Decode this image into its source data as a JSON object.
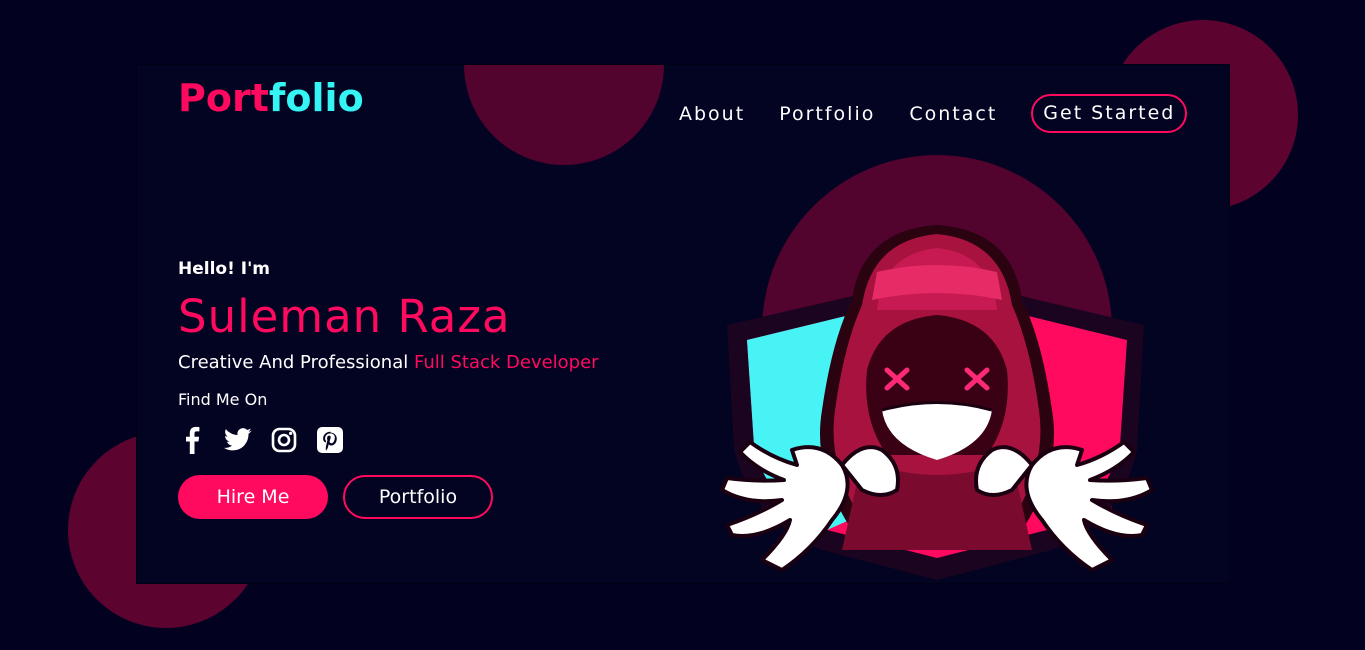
{
  "brand": {
    "logo_part1": "Port",
    "logo_part2": "folio",
    "accent_color": "#ff0a5e",
    "secondary_color": "#35f4f4"
  },
  "nav": {
    "links": [
      "About",
      "Portfolio",
      "Contact"
    ],
    "cta_label": "Get Started"
  },
  "hero": {
    "greeting": "Hello! I'm",
    "name": "Suleman Raza",
    "tagline_prefix": "Creative And Professional ",
    "tagline_highlight": "Full Stack Developer",
    "find_me": "Find Me On",
    "socials": [
      "facebook-icon",
      "twitter-icon",
      "instagram-icon",
      "pinterest-icon"
    ],
    "primary_button": "Hire Me",
    "secondary_button": "Portfolio"
  }
}
